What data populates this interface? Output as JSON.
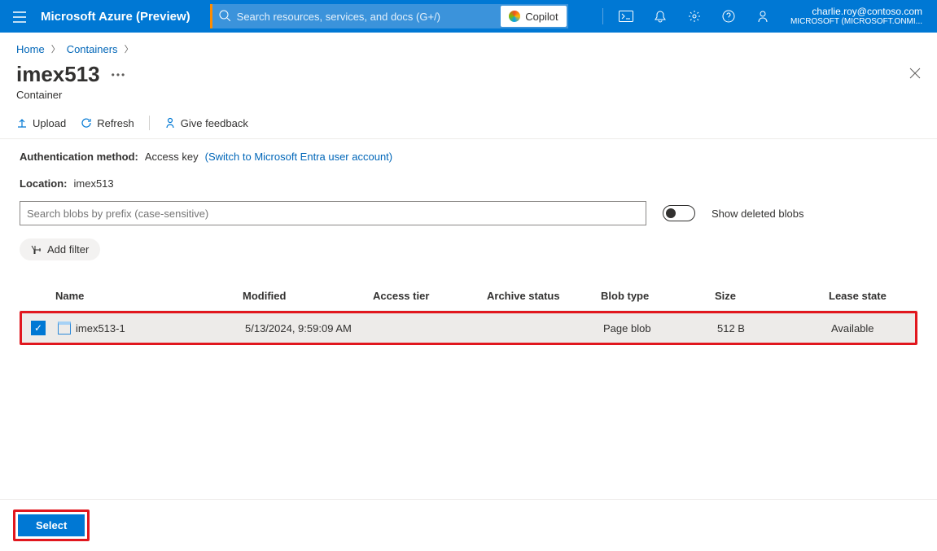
{
  "header": {
    "brand": "Microsoft Azure (Preview)",
    "search_placeholder": "Search resources, services, and docs (G+/)",
    "copilot_label": "Copilot",
    "account_email": "charlie.roy@contoso.com",
    "account_org": "MICROSOFT (MICROSOFT.ONMI..."
  },
  "breadcrumb": {
    "items": [
      "Home",
      "Containers"
    ]
  },
  "page": {
    "title": "imex513",
    "subtitle": "Container"
  },
  "toolbar": {
    "upload": "Upload",
    "refresh": "Refresh",
    "feedback": "Give feedback"
  },
  "info": {
    "auth_label": "Authentication method:",
    "auth_value": "Access key",
    "auth_switch": "(Switch to Microsoft Entra user account)",
    "location_label": "Location:",
    "location_value": "imex513"
  },
  "filters": {
    "search_placeholder": "Search blobs by prefix (case-sensitive)",
    "show_deleted_label": "Show deleted blobs",
    "add_filter": "Add filter"
  },
  "table": {
    "columns": [
      "Name",
      "Modified",
      "Access tier",
      "Archive status",
      "Blob type",
      "Size",
      "Lease state"
    ],
    "rows": [
      {
        "name": "imex513-1",
        "modified": "5/13/2024, 9:59:09 AM",
        "access_tier": "",
        "archive_status": "",
        "blob_type": "Page blob",
        "size": "512 B",
        "lease_state": "Available",
        "selected": true
      }
    ]
  },
  "footer": {
    "select": "Select"
  }
}
